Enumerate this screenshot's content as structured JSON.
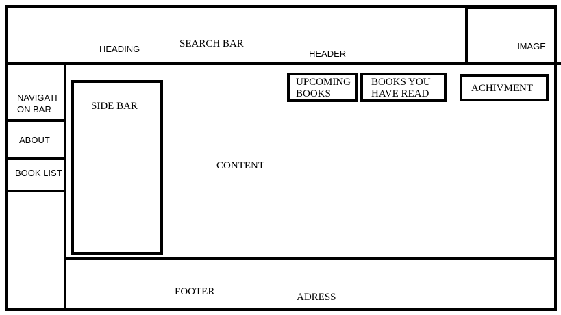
{
  "header": {
    "heading_label": "HEADING",
    "search_bar_label": "SEARCH BAR",
    "header_label": "HEADER",
    "image_label": "IMAGE"
  },
  "navigation": {
    "nav_bar_label_line1": "NAVIGATI",
    "nav_bar_label_line2": "ON BAR",
    "items": [
      {
        "label": "ABOUT"
      },
      {
        "label": "BOOK LIST"
      }
    ]
  },
  "content": {
    "side_bar_label": "SIDE BAR",
    "content_label": "CONTENT",
    "buttons": [
      {
        "label_line1": "UPCOMING",
        "label_line2": "BOOKS"
      },
      {
        "label_line1": "BOOKS YOU",
        "label_line2": "HAVE READ"
      },
      {
        "label_line1": "ACHIVMENT"
      }
    ]
  },
  "footer": {
    "footer_label": "FOOTER",
    "address_label": "ADRESS"
  },
  "colors": {
    "stroke": "#000000",
    "background": "#ffffff"
  }
}
